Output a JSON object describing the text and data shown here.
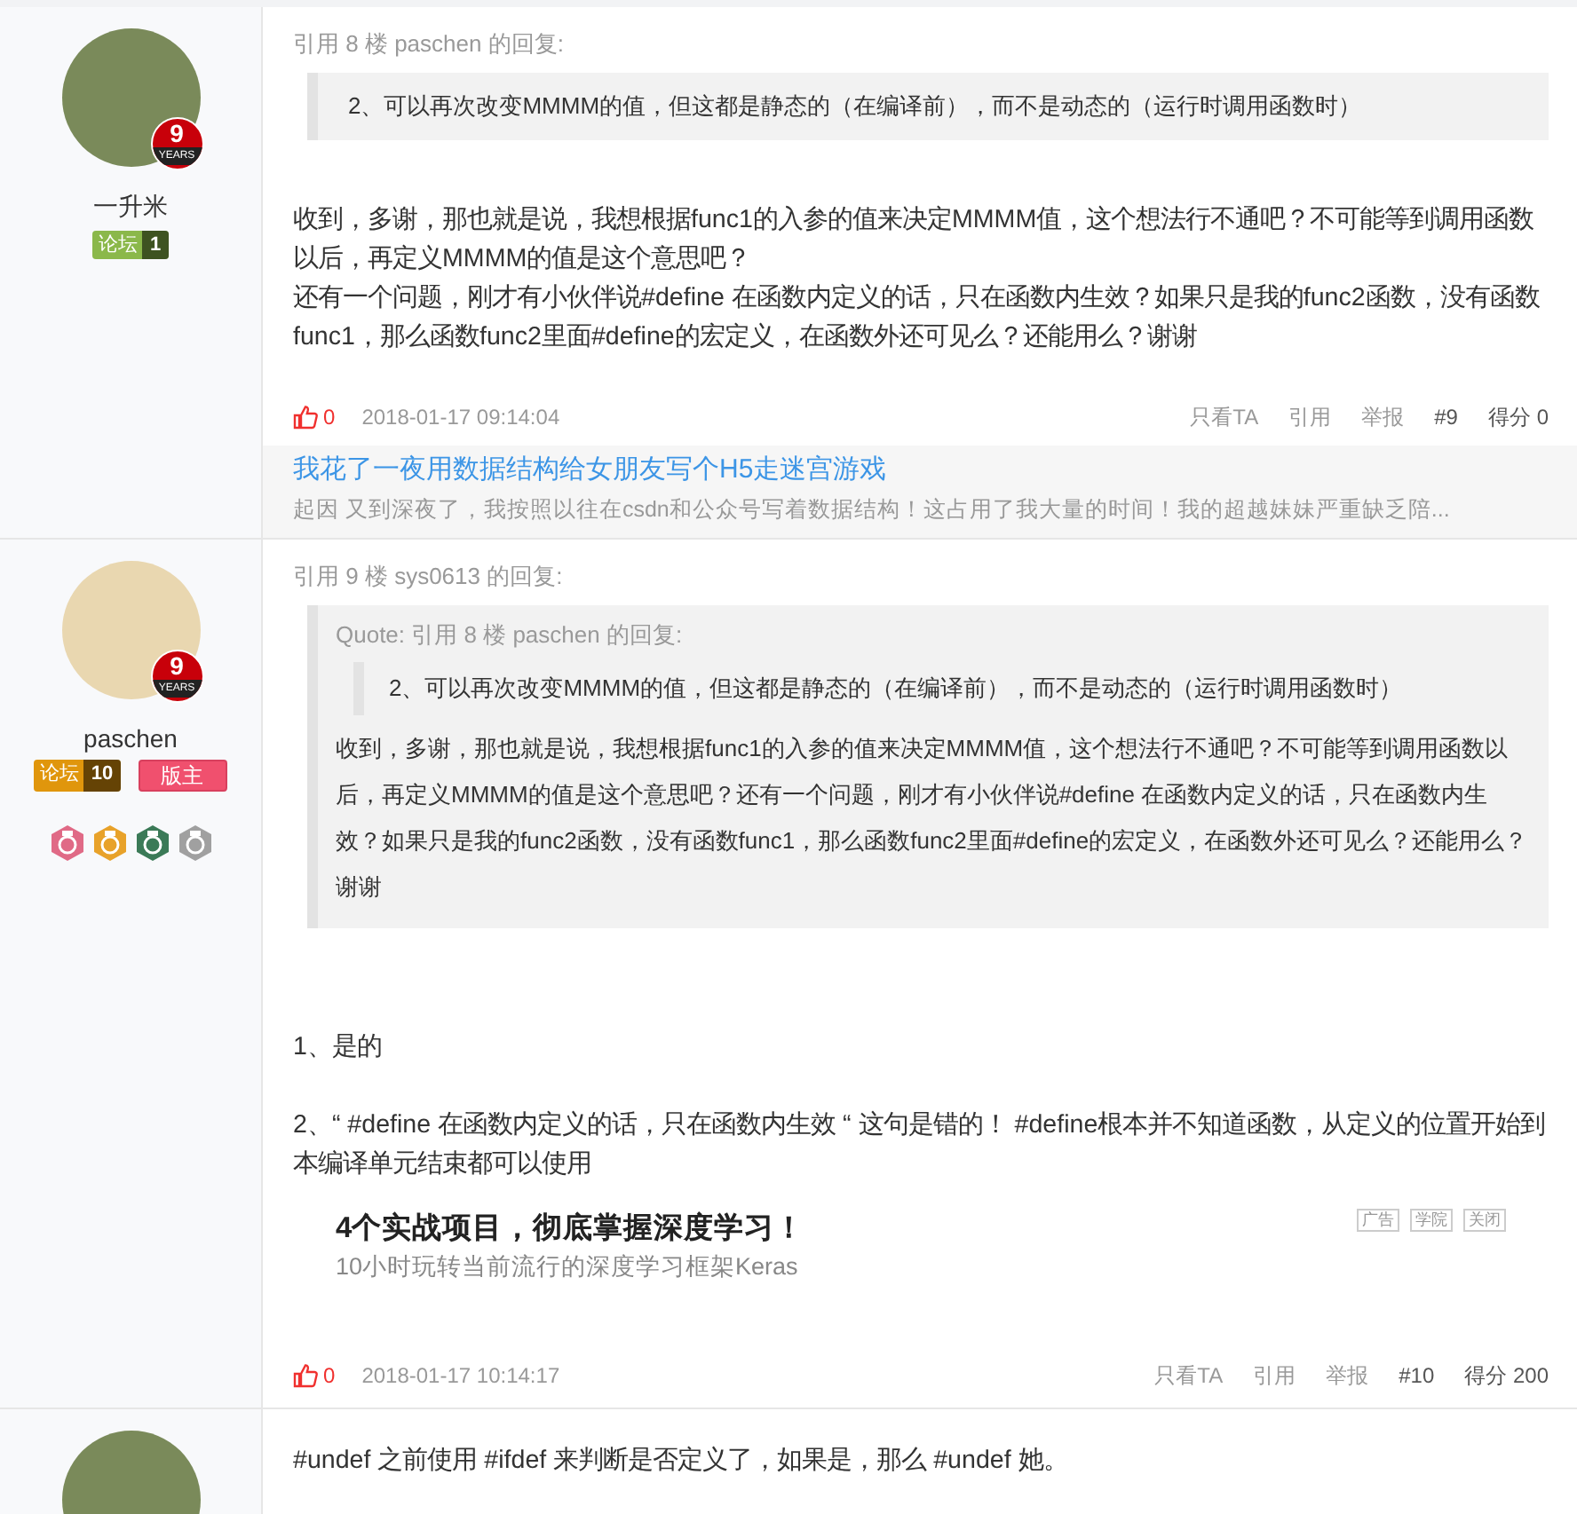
{
  "posts": [
    {
      "user": {
        "name": "一升米",
        "kind": "photo",
        "years": "9",
        "years_label": "YEARS",
        "badges": [
          {
            "label": "论坛",
            "level": "1",
            "color": "#8bb84a"
          }
        ]
      },
      "quote": {
        "header": "引用 8 楼 paschen 的回复:",
        "blocks": [
          "2、可以再次改变MMMM的值，但这都是静态的（在编译前），而不是动态的（运行时调用函数时）"
        ]
      },
      "paragraphs": [
        "收到，多谢，那也就是说，我想根据func1的入参的值来决定MMMM值，这个想法行不通吧？不可能等到调用函数以后，再定义MMMM的值是这个意思吧？",
        "还有一个问题，刚才有小伙伴说#define  在函数内定义的话，只在函数内生效？如果只是我的func2函数，没有函数func1，那么函数func2里面#define的宏定义，在函数外还可见么？还能用么？谢谢"
      ],
      "footer": {
        "likes": "0",
        "time": "2018-01-17 09:14:04",
        "actions": [
          "只看TA",
          "引用",
          "举报"
        ],
        "floor": "#9",
        "score": "得分 0"
      },
      "ad": {
        "kind": "link",
        "title": "我花了一夜用数据结构给女朋友写个H5走迷宫游戏",
        "text": "起因 又到深夜了，我按照以往在csdn和公众号写着数据结构！这占用了我大量的时间！我的超越妹妹严重缺乏陪..."
      }
    },
    {
      "user": {
        "name": "paschen",
        "kind": "cartoon",
        "years": "9",
        "years_label": "YEARS",
        "badges": [
          {
            "label": "论坛",
            "level": "10",
            "color": "#e0960c"
          }
        ],
        "roles": [
          "版主"
        ],
        "medals": [
          {
            "color": "#e06a86"
          },
          {
            "color": "#e8a22a"
          },
          {
            "color": "#3b7a57"
          },
          {
            "color": "#a0a0a0"
          }
        ]
      },
      "quote": {
        "header": "引用 9 楼 sys0613 的回复:",
        "inner_header": "Quote: 引用 8 楼 paschen 的回复:",
        "blocks": [
          "2、可以再次改变MMMM的值，但这都是静态的（在编译前），而不是动态的（运行时调用函数时）"
        ],
        "body": "收到，多谢，那也就是说，我想根据func1的入参的值来决定MMMM值，这个想法行不通吧？不可能等到调用函数以后，再定义MMMM的值是这个意思吧？还有一个问题，刚才有小伙伴说#define  在函数内定义的话，只在函数内生效？如果只是我的func2函数，没有函数func1，那么函数func2里面#define的宏定义，在函数外还可见么？还能用么？谢谢"
      },
      "paragraphs": [
        "1、是的",
        "2、“ #define  在函数内定义的话，只在函数内生效 “ 这句是错的！  #define根本并不知道函数，从定义的位置开始到本编译单元结束都可以使用"
      ],
      "footer": {
        "likes": "0",
        "time": "2018-01-17 10:14:17",
        "actions": [
          "只看TA",
          "引用",
          "举报"
        ],
        "floor": "#10",
        "score": "得分 200"
      },
      "ad": {
        "kind": "course",
        "title": "4个实战项目，彻底掌握深度学习！",
        "text": "10小时玩转当前流行的深度学习框架Keras",
        "tags": [
          "广告",
          "学院",
          "关闭"
        ]
      }
    },
    {
      "user": {
        "kind": "photo"
      },
      "paragraphs": [
        "#undef 之前使用 #ifdef 来判断是否定义了，如果是，那么 #undef 她。"
      ]
    }
  ]
}
